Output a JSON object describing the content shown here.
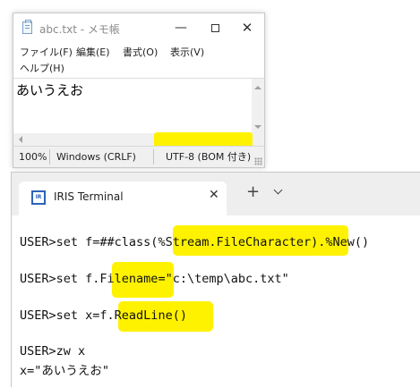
{
  "notepad": {
    "title": "abc.txt - メモ帳",
    "controls": {
      "minimize": "—",
      "close": "✕"
    },
    "menu": [
      {
        "label": "ファイル(F)"
      },
      {
        "label": "編集(E)"
      },
      {
        "label": "書式(O)"
      },
      {
        "label": "表示(V)"
      },
      {
        "label": "ヘルプ(H)"
      }
    ],
    "content": "あいうえお",
    "status": {
      "zoom": "100%",
      "line_ending": "Windows (CRLF)",
      "encoding": "UTF-8 (BOM 付き)"
    },
    "highlight_color": "#fff200"
  },
  "terminal": {
    "tab_title": "IRIS Terminal",
    "logo_text": "IR",
    "tab_close": "✕",
    "new_tab": "+",
    "lines": [
      {
        "prompt": "USER>set f=##class(",
        "hl": "%Stream.FileCharacter",
        "rest": ").%New()"
      },
      {
        "prompt": "USER>set f.",
        "hl": "Filename",
        "rest": "=\"c:\\temp\\abc.txt\""
      },
      {
        "prompt": "USER>set x=f.",
        "hl": "ReadLine()",
        "rest": ""
      },
      {
        "text": "USER>zw x"
      },
      {
        "text": "x=\"あいうえお\""
      }
    ]
  }
}
